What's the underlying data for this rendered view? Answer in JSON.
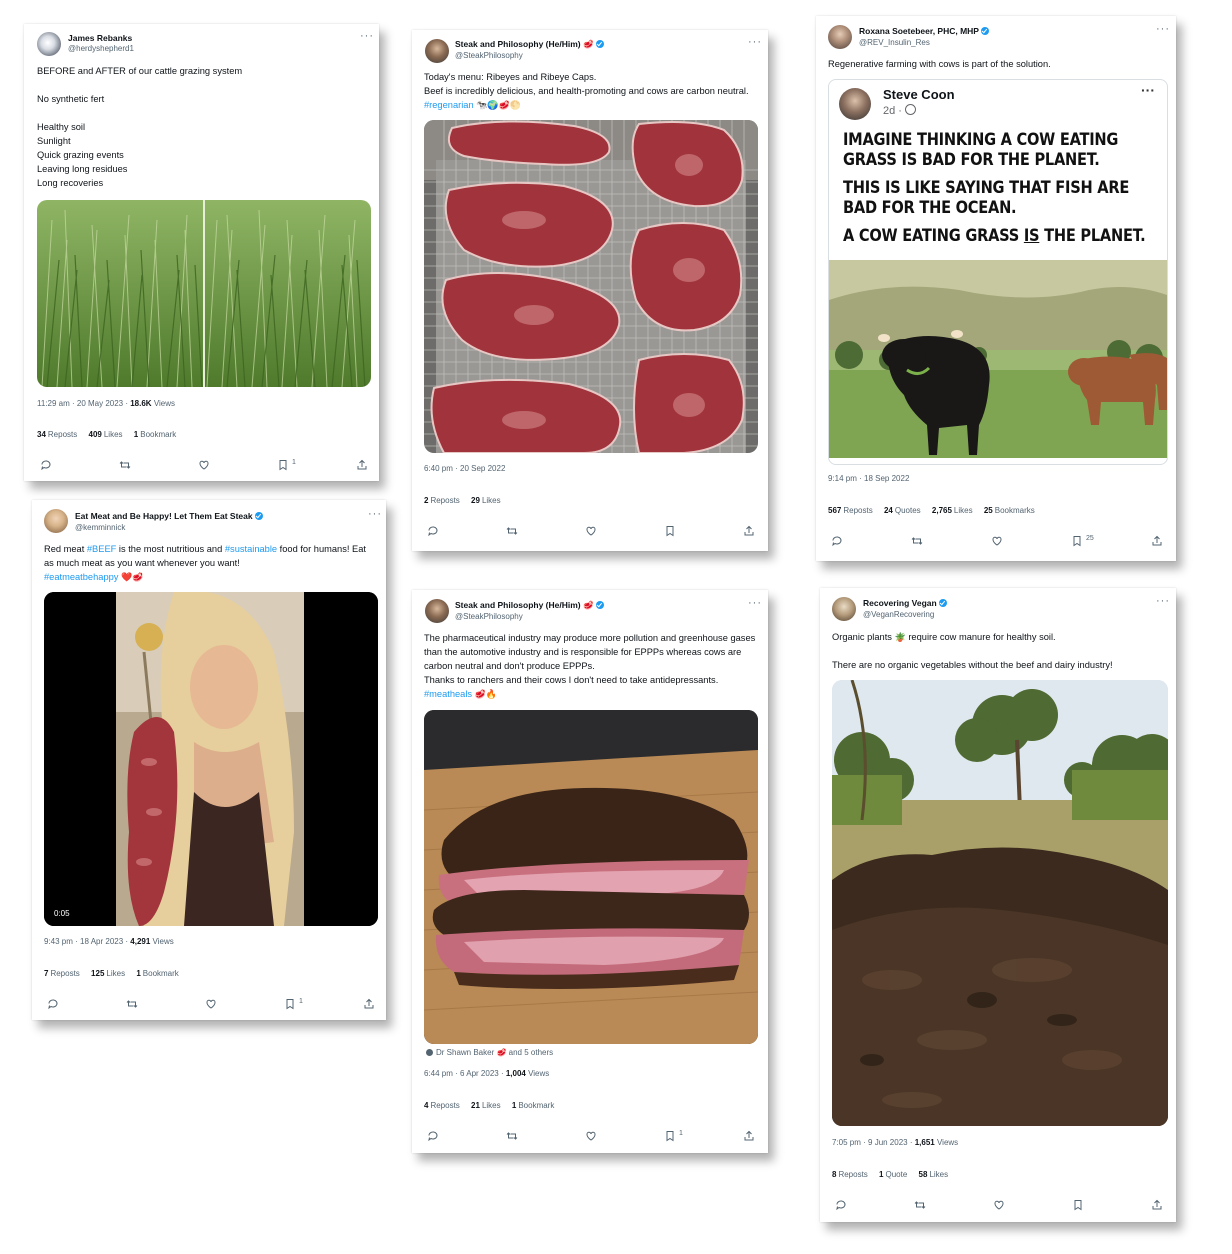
{
  "tweets": {
    "t1": {
      "name": "James Rebanks",
      "handle": "@herdyshepherd1",
      "text": "BEFORE and AFTER of our cattle grazing system\n\nNo synthetic fert\n\nHealthy soil\nSunlight\nQuick grazing events\nLeaving long residues\nLong recoveries",
      "time": "11:29 am · 20 May 2023 · ",
      "views": "18.6K",
      "views_label": " Views",
      "reposts": "34",
      "reposts_label": "Reposts",
      "likes": "409",
      "likes_label": "Likes",
      "bookmarks": "1",
      "bookmarks_label": "Bookmark",
      "bookmark_count": "1"
    },
    "t2": {
      "name": "Steak and Philosophy (He/Him) 🥩",
      "handle": "@SteakPhilosophy",
      "text_plain": "Today's menu: Ribeyes and Ribeye Caps.\nBeef is incredibly delicious, and health-promoting and cows are carbon neutral. ",
      "hashtag": "#regenarian",
      "emoji": " 🐄🌍🥩🌕",
      "time": "6:40 pm · 20 Sep 2022",
      "reposts": "2",
      "reposts_label": "Reposts",
      "likes": "29",
      "likes_label": "Likes"
    },
    "t3": {
      "name": "Roxana Soetebeer, PHC, MHP",
      "handle": "@REV_Insulin_Res",
      "text": "Regenerative farming with cows is part of the solution.",
      "embed_name": "Steve Coon",
      "embed_time": "2d · ",
      "embed_line1": "IMAGINE THINKING A COW EATING GRASS IS BAD FOR THE PLANET.",
      "embed_line2": "THIS IS LIKE SAYING THAT FISH ARE BAD FOR THE OCEAN.",
      "embed_line3a": "A COW EATING GRASS ",
      "embed_line3b": "IS",
      "embed_line3c": " THE PLANET.",
      "time": "9:14 pm · 18 Sep 2022",
      "reposts": "567",
      "reposts_label": "Reposts",
      "quotes": "24",
      "quotes_label": "Quotes",
      "likes": "2,765",
      "likes_label": "Likes",
      "bookmarks": "25",
      "bookmarks_label": "Bookmarks",
      "bookmark_count": "25"
    },
    "t4": {
      "name": "Eat Meat and Be Happy! Let Them Eat Steak",
      "handle": "@kemminnick",
      "text_a": "Red meat ",
      "tag_a": "#BEEF",
      "text_b": " is the most nutritious and ",
      "tag_b": "#sustainable",
      "text_c": " food for humans! Eat as much meat as you want whenever you want!\n",
      "tag_c": "#eatmeatbehappy",
      "emoji": " ❤️🥩",
      "video_time": "0:05",
      "time": "9:43 pm · 18 Apr 2023 · ",
      "views": "4,291",
      "views_label": " Views",
      "reposts": "7",
      "reposts_label": "Reposts",
      "likes": "125",
      "likes_label": "Likes",
      "bookmarks": "1",
      "bookmarks_label": "Bookmark",
      "bookmark_count": "1"
    },
    "t5": {
      "name": "Steak and Philosophy (He/Him) 🥩",
      "handle": "@SteakPhilosophy",
      "text": "The pharmaceutical industry may produce more pollution and greenhouse gases than the automotive industry and is responsible for EPPPs whereas cows are carbon neutral and don't produce EPPPs.\nThanks to ranchers and their cows I don't need to take antidepressants.\n",
      "hashtag": "#meatheals",
      "emoji": " 🥩🔥",
      "tagged": "Dr Shawn Baker 🥩 and 5 others",
      "time": "6:44 pm · 6 Apr 2023 · ",
      "views": "1,004",
      "views_label": " Views",
      "reposts": "4",
      "reposts_label": "Reposts",
      "likes": "21",
      "likes_label": "Likes",
      "bookmarks": "1",
      "bookmarks_label": "Bookmark",
      "bookmark_count": "1"
    },
    "t6": {
      "name": "Recovering Vegan",
      "handle": "@VeganRecovering",
      "text_a": "Organic plants ",
      "emoji": "🪴",
      "text_b": " require cow manure for healthy soil.\n\nThere are no organic vegetables without the beef and dairy industry!",
      "time": "7:05 pm · 9 Jun 2023 · ",
      "views": "1,651",
      "views_label": " Views",
      "reposts": "8",
      "reposts_label": "Reposts",
      "quotes": "1",
      "quotes_label": "Quote",
      "likes": "58",
      "likes_label": "Likes"
    }
  },
  "colors": {
    "link": "#1d9bf0",
    "muted": "#536471",
    "text": "#0f1419"
  },
  "icons": [
    "reply-icon",
    "repost-icon",
    "like-icon",
    "bookmark-icon",
    "share-icon",
    "more-icon",
    "verified-icon",
    "globe-icon",
    "person-icon"
  ]
}
